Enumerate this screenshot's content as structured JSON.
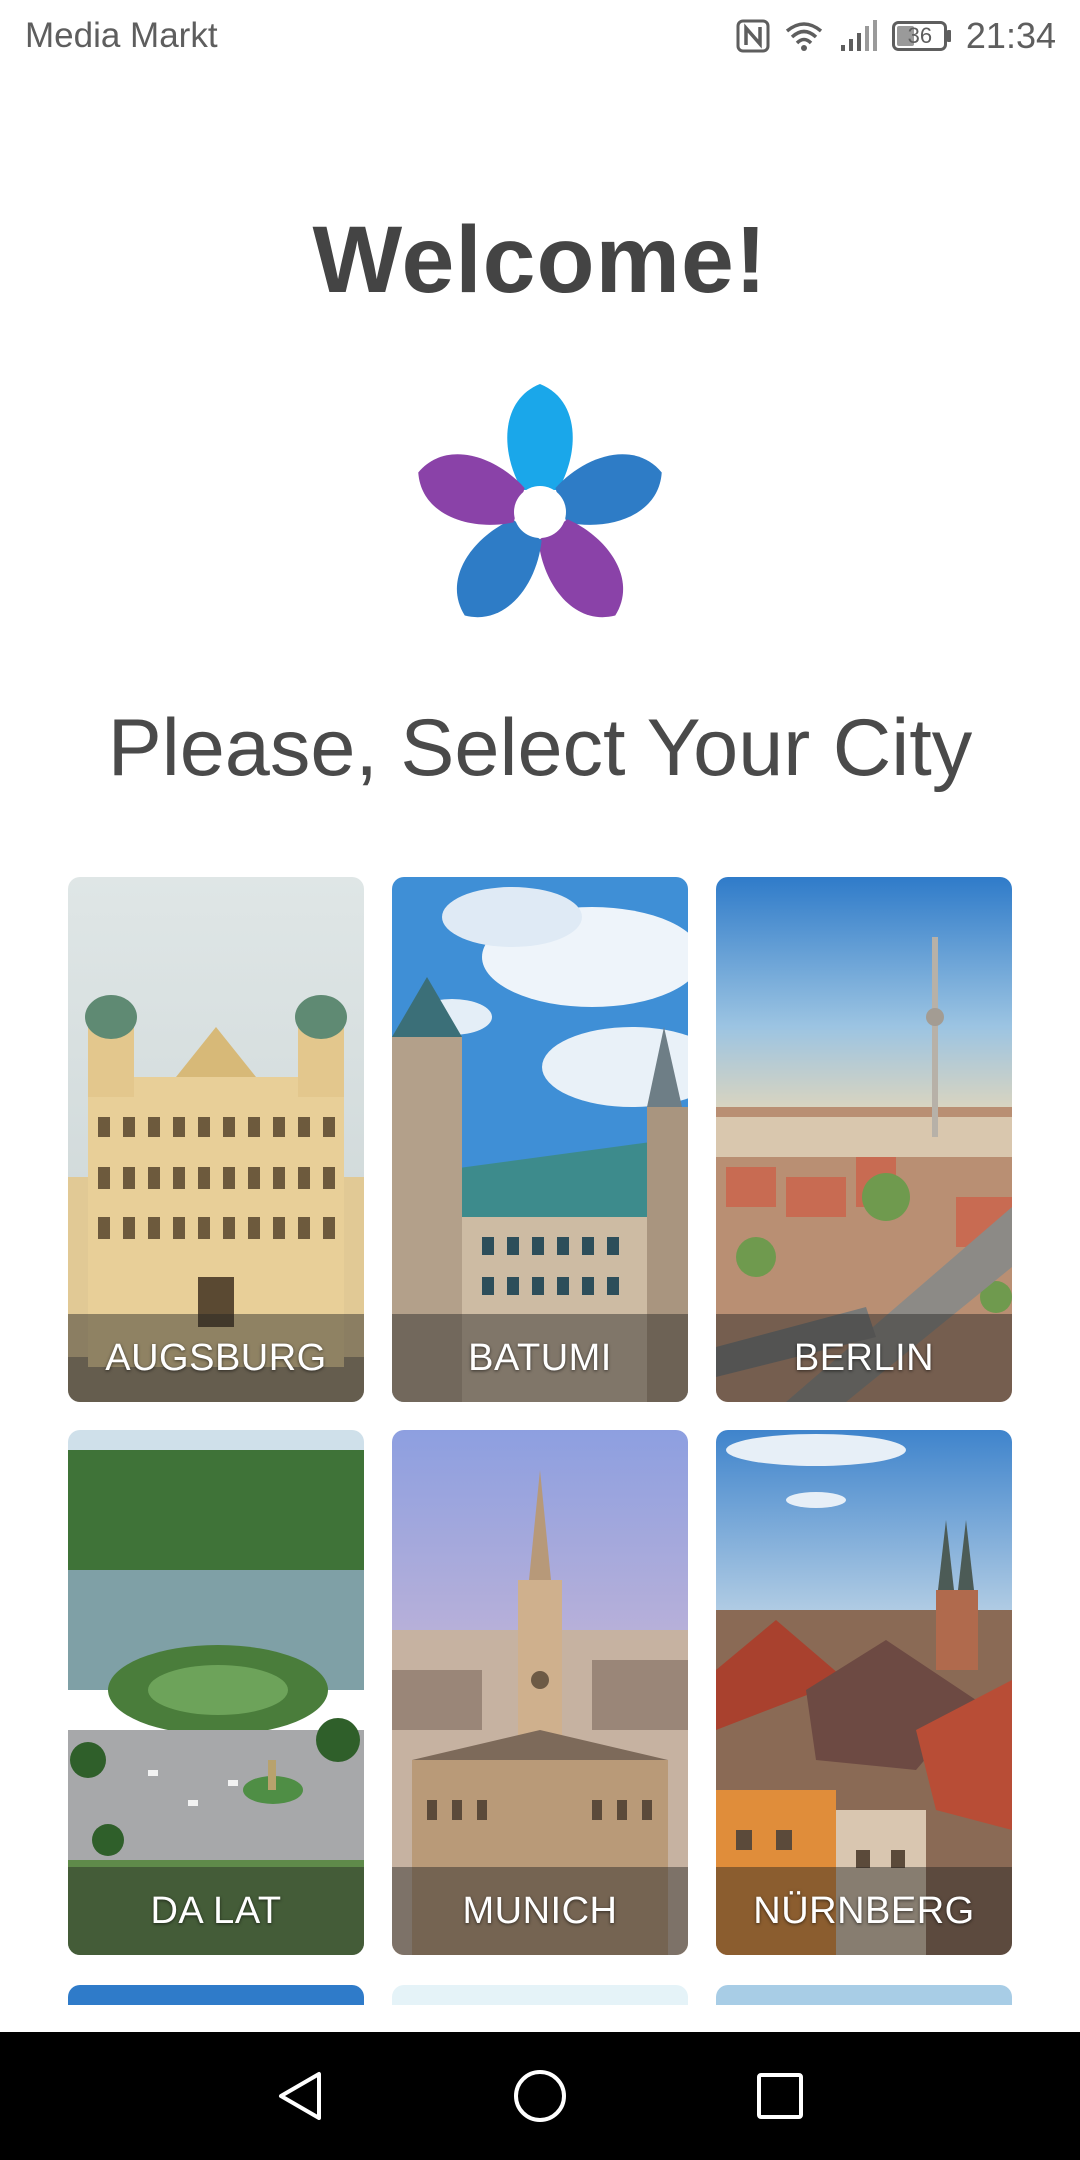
{
  "status_bar": {
    "carrier": "Media Markt",
    "battery": "36",
    "time": "21:34",
    "icons": [
      "nfc-icon",
      "wifi-icon",
      "signal-icon",
      "battery-icon"
    ]
  },
  "welcome": {
    "title": "Welcome!",
    "subtitle": "Please, Select Your City",
    "logo": "app-logo-star-icon"
  },
  "colors": {
    "heading": "#444444",
    "logo_blue_light": "#1aa7ea",
    "logo_blue_dark": "#2e7cc6",
    "logo_purple": "#8a42a8",
    "label_band": "rgba(35,35,35,0.45)"
  },
  "cities": [
    {
      "name": "AUGSBURG"
    },
    {
      "name": "BATUMI"
    },
    {
      "name": "BERLIN"
    },
    {
      "name": "DA LAT"
    },
    {
      "name": "MUNICH"
    },
    {
      "name": "NÜRNBERG"
    }
  ],
  "navigation": {
    "buttons": [
      "back-icon",
      "home-icon",
      "recents-icon"
    ]
  }
}
